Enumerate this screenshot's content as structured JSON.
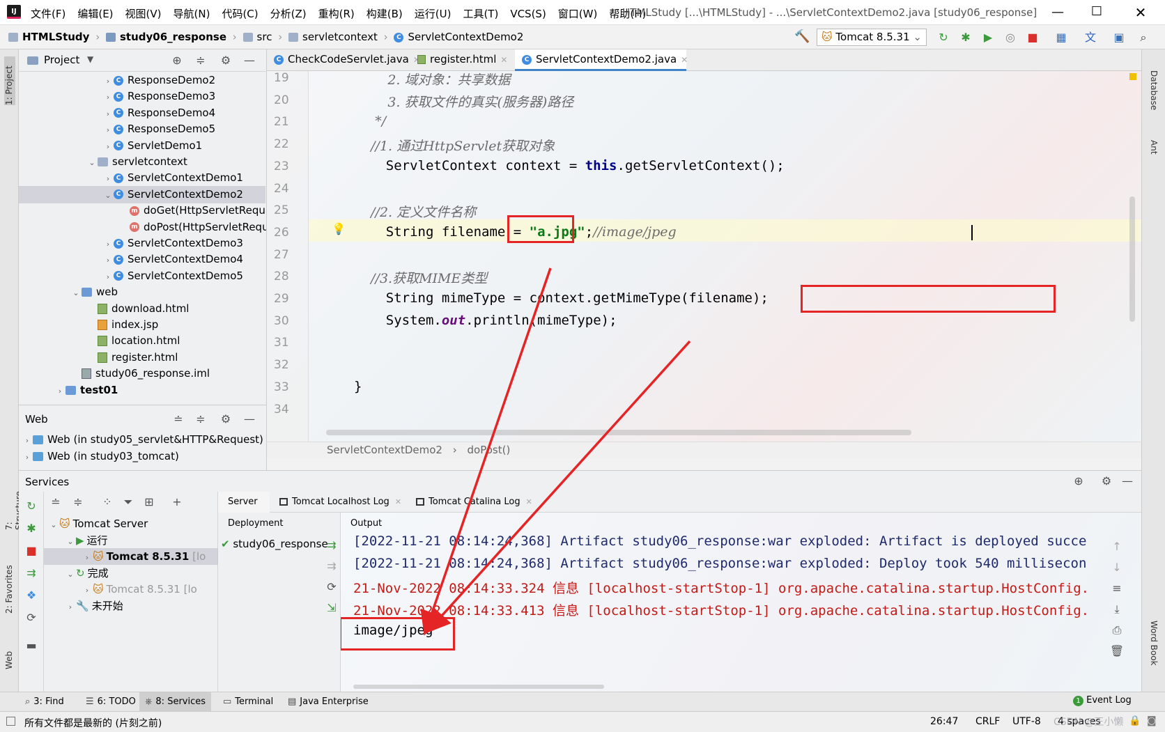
{
  "menu": {
    "items": [
      "文件(F)",
      "编辑(E)",
      "视图(V)",
      "导航(N)",
      "代码(C)",
      "分析(Z)",
      "重构(R)",
      "构建(B)",
      "运行(U)",
      "工具(T)",
      "VCS(S)",
      "窗口(W)",
      "帮助(H)"
    ],
    "window_title": "HTMLStudy [...\\HTMLStudy] - ...\\ServletContextDemo2.java [study06_response]"
  },
  "breadcrumb": [
    "HTMLStudy",
    "study06_response",
    "src",
    "servletcontext",
    "ServletContextDemo2"
  ],
  "run_config": "Tomcat 8.5.31",
  "project_panel": {
    "title": "Project",
    "tree": [
      {
        "label": "ResponseDemo2",
        "type": "class",
        "indent": 2,
        "chev": "›"
      },
      {
        "label": "ResponseDemo3",
        "type": "class",
        "indent": 2,
        "chev": "›"
      },
      {
        "label": "ResponseDemo4",
        "type": "class",
        "indent": 2,
        "chev": "›"
      },
      {
        "label": "ResponseDemo5",
        "type": "class",
        "indent": 2,
        "chev": "›"
      },
      {
        "label": "ServletDemo1",
        "type": "class",
        "indent": 2,
        "chev": "›"
      },
      {
        "label": "servletcontext",
        "type": "package",
        "indent": 1,
        "chev": "⌄"
      },
      {
        "label": "ServletContextDemo1",
        "type": "class",
        "indent": 2,
        "chev": "›"
      },
      {
        "label": "ServletContextDemo2",
        "type": "class",
        "indent": 2,
        "chev": "⌄",
        "selected": true
      },
      {
        "label": "doGet(HttpServletRequ",
        "type": "method",
        "indent": 3,
        "chev": ""
      },
      {
        "label": "doPost(HttpServletRequ",
        "type": "method",
        "indent": 3,
        "chev": ""
      },
      {
        "label": "ServletContextDemo3",
        "type": "class",
        "indent": 2,
        "chev": "›"
      },
      {
        "label": "ServletContextDemo4",
        "type": "class",
        "indent": 2,
        "chev": "›"
      },
      {
        "label": "ServletContextDemo5",
        "type": "class",
        "indent": 2,
        "chev": "›"
      },
      {
        "label": "web",
        "type": "folder",
        "indent": 0,
        "chev": "⌄"
      },
      {
        "label": "download.html",
        "type": "html",
        "indent": 1,
        "chev": ""
      },
      {
        "label": "index.jsp",
        "type": "jsp",
        "indent": 1,
        "chev": ""
      },
      {
        "label": "location.html",
        "type": "html",
        "indent": 1,
        "chev": ""
      },
      {
        "label": "register.html",
        "type": "html",
        "indent": 1,
        "chev": ""
      },
      {
        "label": "study06_response.iml",
        "type": "iml",
        "indent": 0,
        "chev": ""
      },
      {
        "label": "test01",
        "type": "folder",
        "indent": -1,
        "chev": "›"
      }
    ]
  },
  "web_panel": {
    "title": "Web",
    "items": [
      "Web (in study05_servlet&HTTP&Request)",
      "Web (in study03_tomcat)"
    ]
  },
  "editor": {
    "tabs": [
      {
        "label": "CheckCodeServlet.java",
        "icon": "C",
        "active": false
      },
      {
        "label": "register.html",
        "icon": "H",
        "active": false
      },
      {
        "label": "ServletContextDemo2.java",
        "icon": "C",
        "active": true
      }
    ],
    "lines": [
      {
        "n": "19",
        "html": "<span class=\"cm\">        2. 域对象：共享数据</span>"
      },
      {
        "n": "20",
        "html": "<span class=\"cm\">        3. 获取文件的真实(服务器)路径</span>"
      },
      {
        "n": "21",
        "html": "<span class=\"cm\">     */</span>"
      },
      {
        "n": "22",
        "html": "<span class=\"cm\">    //1. 通过HttpServlet获取对象</span>"
      },
      {
        "n": "23",
        "html": "    ServletContext context = <span class=\"kw\">this</span>.getServletContext();"
      },
      {
        "n": "24",
        "html": ""
      },
      {
        "n": "25",
        "html": "<span class=\"cm\">    //2. 定义文件名称</span>"
      },
      {
        "n": "26",
        "html": "    String filename = <span class=\"str\">\"a.jpg\"</span>;<span class=\"cm\">//image/jpeg</span>"
      },
      {
        "n": "27",
        "html": ""
      },
      {
        "n": "28",
        "html": "<span class=\"cm\">    //3.获取MIME类型</span>"
      },
      {
        "n": "29",
        "html": "    String mimeType = context.getMimeType(filename);"
      },
      {
        "n": "30",
        "html": "    System.<span style=\"color:#660e7a;font-style:italic;font-weight:bold\">out</span>.println(mimeType);"
      },
      {
        "n": "31",
        "html": ""
      },
      {
        "n": "32",
        "html": ""
      },
      {
        "n": "33",
        "html": "}"
      },
      {
        "n": "34",
        "html": ""
      }
    ],
    "crumb": [
      "ServletContextDemo2",
      "doPost()"
    ]
  },
  "services": {
    "title": "Services",
    "tree": [
      {
        "label": "Tomcat Server",
        "indent": 0,
        "chev": "⌄",
        "icon": "🐱"
      },
      {
        "label": "运行",
        "indent": 1,
        "chev": "⌄",
        "icon": "▶"
      },
      {
        "label": "Tomcat 8.5.31",
        "suffix": "[lo",
        "indent": 2,
        "chev": "›",
        "icon": "🐱",
        "bold": true,
        "selected": true
      },
      {
        "label": "完成",
        "indent": 1,
        "chev": "⌄",
        "icon": "↻"
      },
      {
        "label": "Tomcat 8.5.31",
        "suffix": "[lo",
        "indent": 2,
        "chev": "›",
        "icon": "🐱",
        "gray": true
      },
      {
        "label": "未开始",
        "indent": 1,
        "chev": "›",
        "icon": "🔧"
      }
    ],
    "tabs": [
      "Server",
      "Tomcat Localhost Log",
      "Tomcat Catalina Log"
    ],
    "deployment_label": "Deployment",
    "output_label": "Output",
    "deployment_item": "study06_response",
    "output_lines": [
      {
        "text": "[2022-11-21 08:14:24,368] Artifact study06_response:war exploded: Artifact is deployed succe",
        "color": "#1f2a6a"
      },
      {
        "text": "[2022-11-21 08:14:24,368] Artifact study06_response:war exploded: Deploy took 540 millisecon",
        "color": "#1f2a6a"
      },
      {
        "text": "21-Nov-2022 08:14:33.324 信息 [localhost-startStop-1] org.apache.catalina.startup.HostConfig.",
        "color": "#c41a16"
      },
      {
        "text": "21-Nov-2022 08:14:33.413 信息 [localhost-startStop-1] org.apache.catalina.startup.HostConfig.",
        "color": "#c41a16"
      },
      {
        "text": "image/jpeg",
        "color": "#000"
      }
    ]
  },
  "bottom_tabs": [
    {
      "num": "3",
      "label": "3: Find"
    },
    {
      "num": "6",
      "label": "6: TODO"
    },
    {
      "num": "8",
      "label": "8: Services",
      "active": true
    },
    {
      "num": "",
      "label": "Terminal"
    },
    {
      "num": "",
      "label": "Java Enterprise"
    }
  ],
  "event_log": "Event Log",
  "event_count": "1",
  "status": {
    "message": "所有文件都是最新的 (片刻之前)",
    "position": "26:47",
    "line_sep": "CRLF",
    "encoding": "UTF-8",
    "indent": "4 spaces"
  },
  "left_vtabs": [
    "1: Project",
    "7: Structure",
    "2: Favorites",
    "Web"
  ],
  "right_vtabs": [
    "Database",
    "Ant",
    "Word Book"
  ],
  "watermark": "CSDN @王小懒"
}
